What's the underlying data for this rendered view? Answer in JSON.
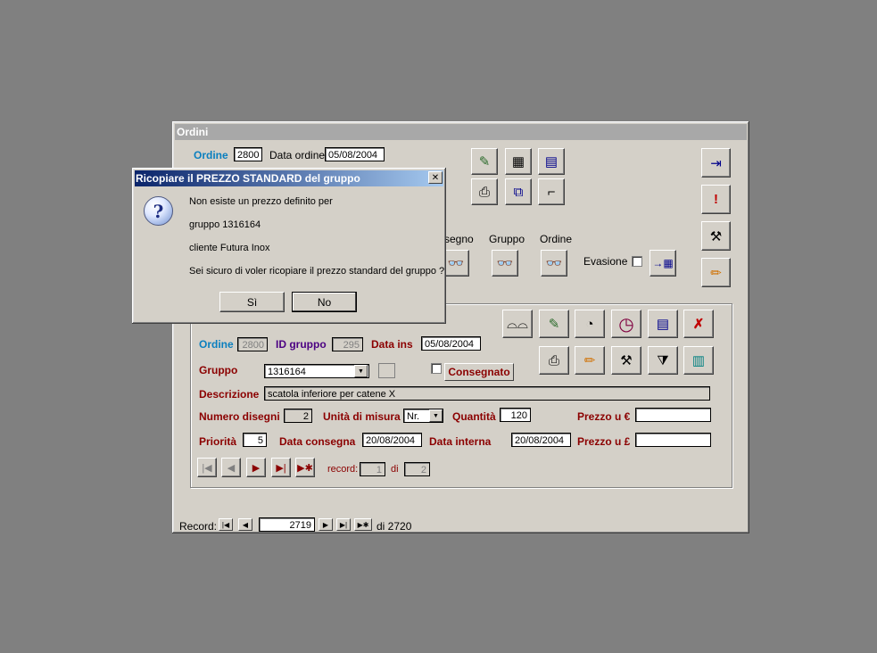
{
  "window": {
    "title": "Ordini"
  },
  "header": {
    "ordine_label": "Ordine",
    "ordine_value": "2800",
    "data_ordine_label": "Data ordine",
    "data_ordine_value": "05/08/2004"
  },
  "search": {
    "disegno_label": "segno",
    "gruppo_label": "Gruppo",
    "ordine_label": "Ordine",
    "evasione_label": "Evasione"
  },
  "detail": {
    "ordine_label": "Ordine",
    "ordine_value": "2800",
    "id_gruppo_label": "ID gruppo",
    "id_gruppo_value": "295",
    "data_ins_label": "Data ins",
    "data_ins_value": "05/08/2004",
    "gruppo_label": "Gruppo",
    "gruppo_value": "1316164",
    "consegnato_label": "Consegnato",
    "descrizione_label": "Descrizione",
    "descrizione_value": "scatola inferiore per catene X",
    "numero_disegni_label": "Numero disegni",
    "numero_disegni_value": "2",
    "unita_label": "Unità di misura",
    "unita_value": "Nr.",
    "quantita_label": "Quantità",
    "quantita_value": "120",
    "prezzo_euro_label": "Prezzo u €",
    "prezzo_euro_value": "",
    "priorita_label": "Priorità",
    "priorita_value": "5",
    "data_consegna_label": "Data consegna",
    "data_consegna_value": "20/08/2004",
    "data_interna_label": "Data interna",
    "data_interna_value": "20/08/2004",
    "prezzo_sterlina_label": "Prezzo u £",
    "prezzo_sterlina_value": "",
    "record_label": "record:",
    "record_value": "1",
    "di_label": "di",
    "di_value": "2"
  },
  "footer": {
    "record_label": "Record:",
    "record_value": "2719",
    "total": "di 2720"
  },
  "dialog": {
    "title": "Ricopiare il PREZZO STANDARD del gruppo",
    "line1": "Non esiste un prezzo definito per",
    "line2": "gruppo 1316164",
    "line3": "cliente Futura Inox",
    "line4": "Sei sicuro di voler ricopiare il prezzo standard del gruppo ?",
    "yes_label": "Sì",
    "no_label": "No",
    "icon": "question-icon"
  },
  "colors": {
    "desktop": "#808080",
    "window": "#d4d0c8",
    "label_blue": "#0a7fbf",
    "label_red": "#8b0000",
    "label_purple": "#4b0082",
    "title_gradient_start": "#0a246a",
    "title_gradient_end": "#a6caf0"
  }
}
